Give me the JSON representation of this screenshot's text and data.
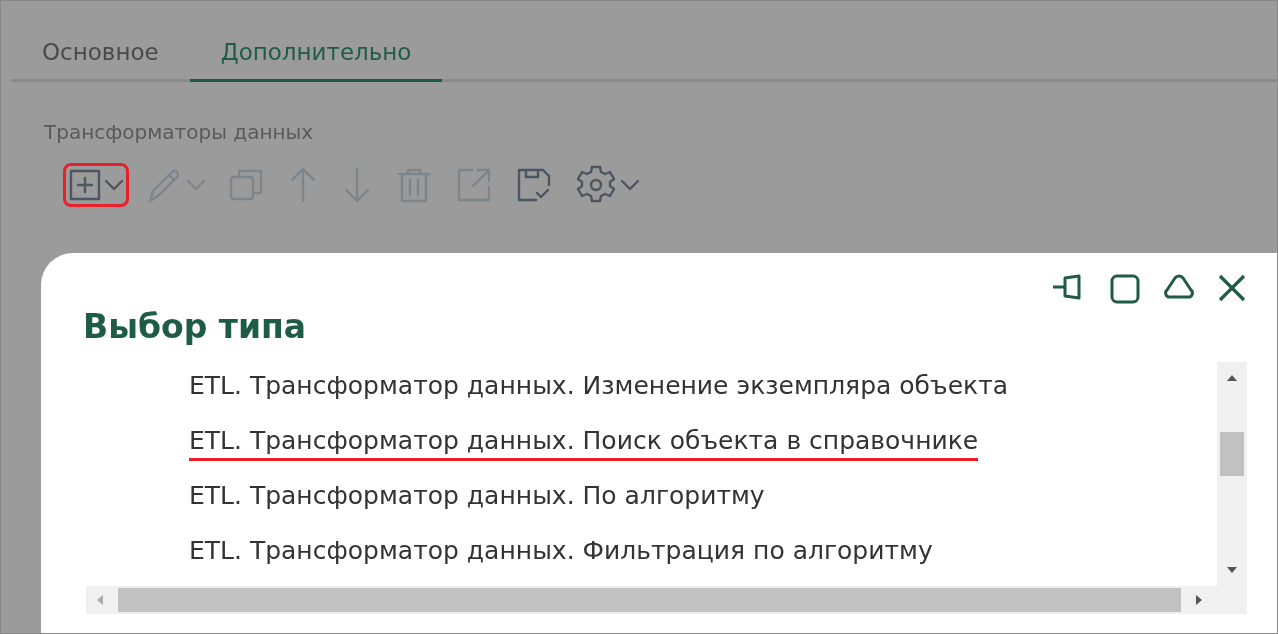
{
  "tabs": [
    {
      "label": "Основное",
      "selected": false
    },
    {
      "label": "Дополнительно",
      "selected": true
    }
  ],
  "section_label": "Трансформаторы данных",
  "toolbar": [
    {
      "kind": "add",
      "disabled": false,
      "dropdown": true,
      "highlighted": true
    },
    {
      "kind": "edit",
      "disabled": true,
      "dropdown": true,
      "highlighted": false
    },
    {
      "kind": "copy",
      "disabled": true,
      "dropdown": false,
      "highlighted": false
    },
    {
      "kind": "up",
      "disabled": true,
      "dropdown": false,
      "highlighted": false
    },
    {
      "kind": "down",
      "disabled": true,
      "dropdown": false,
      "highlighted": false
    },
    {
      "kind": "delete",
      "disabled": true,
      "dropdown": false,
      "highlighted": false
    },
    {
      "kind": "open",
      "disabled": true,
      "dropdown": false,
      "highlighted": false
    },
    {
      "kind": "save",
      "disabled": false,
      "dropdown": false,
      "highlighted": false
    },
    {
      "kind": "settings",
      "disabled": false,
      "dropdown": true,
      "highlighted": false
    }
  ],
  "dialog": {
    "title": "Выбор типа",
    "items": [
      {
        "label": "ETL. Трансформатор данных. Изменение экземпляра объекта",
        "highlighted": false
      },
      {
        "label": "ETL. Трансформатор данных. Поиск объекта в справочнике",
        "highlighted": true
      },
      {
        "label": "ETL. Трансформатор данных. По алгоритму",
        "highlighted": false
      },
      {
        "label": "ETL. Трансформатор данных. Фильтрация по алгоритму",
        "highlighted": false
      }
    ]
  }
}
